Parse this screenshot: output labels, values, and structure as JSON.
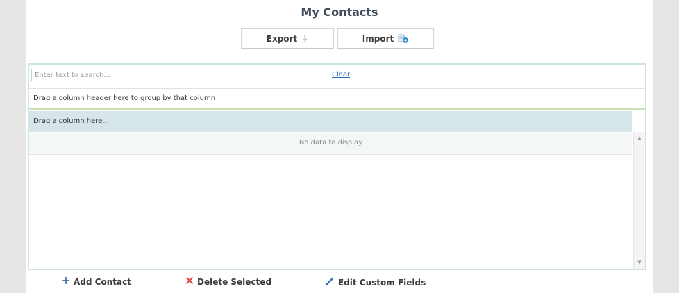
{
  "page": {
    "title": "My Contacts"
  },
  "toolbar": {
    "export_label": "Export",
    "import_label": "Import"
  },
  "grid": {
    "search_placeholder": "Enter text to search...",
    "clear_label": "Clear",
    "group_panel_text": "Drag a column header here to group by that column",
    "header_placeholder": "Drag a column here...",
    "empty_text": "No data to display"
  },
  "actions": {
    "add_label": "Add Contact",
    "delete_label": "Delete Selected",
    "edit_label": "Edit Custom Fields"
  },
  "colors": {
    "add_icon": "#2f5f9e",
    "delete_icon": "#e0443a",
    "edit_icon": "#2f6fbf",
    "import_icon": "#3a8fd0",
    "grid_header_bg": "#d6e6e8"
  }
}
